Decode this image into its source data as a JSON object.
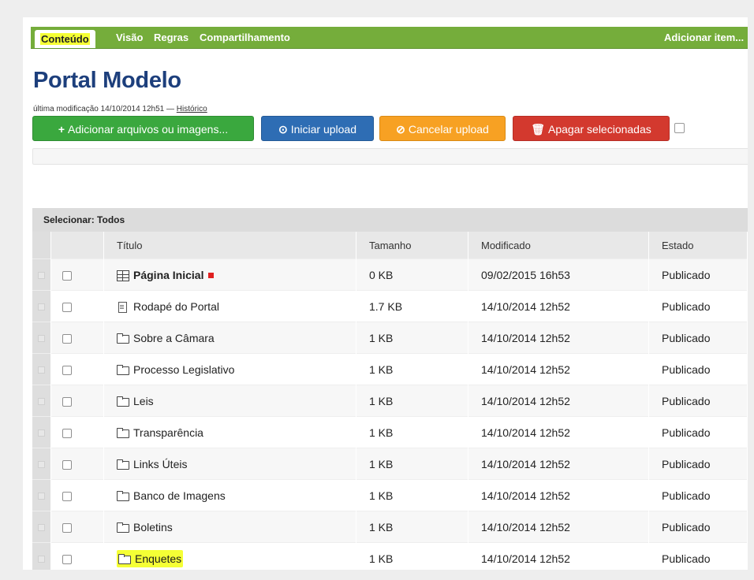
{
  "tabs": [
    {
      "label": "Conteúdo",
      "active": true
    },
    {
      "label": "Visão"
    },
    {
      "label": "Regras"
    },
    {
      "label": "Compartilhamento"
    }
  ],
  "toolbar_right": "Adicionar item...",
  "page_title": "Portal Modelo",
  "byline": {
    "text": "última modificação 14/10/2014 12h51 —",
    "link": "Histórico"
  },
  "buttons": {
    "add": {
      "icon": "+",
      "label": "Adicionar arquivos ou imagens..."
    },
    "start": {
      "icon": "⊙",
      "label": "Iniciar upload"
    },
    "cancel": {
      "icon": "⊘",
      "label": "Cancelar upload"
    },
    "delete": {
      "icon": "🗑",
      "label": "Apagar selecionadas"
    }
  },
  "select_bar": {
    "label": "Selecionar:",
    "value": "Todos"
  },
  "columns": [
    "Título",
    "Tamanho",
    "Modificado",
    "Estado"
  ],
  "rows": [
    {
      "icon": "grid-icon",
      "title": "Página Inicial",
      "size": "0 KB",
      "modified": "09/02/2015 16h53",
      "state": "Publicado"
    },
    {
      "icon": "page-icon",
      "title": "Rodapé do Portal",
      "size": "1.7 KB",
      "modified": "14/10/2014 12h52",
      "state": "Publicado"
    },
    {
      "icon": "folder-icon",
      "title": "Sobre a Câmara",
      "size": "1 KB",
      "modified": "14/10/2014 12h52",
      "state": "Publicado"
    },
    {
      "icon": "folder-icon",
      "title": "Processo Legislativo",
      "size": "1 KB",
      "modified": "14/10/2014 12h52",
      "state": "Publicado"
    },
    {
      "icon": "folder-icon",
      "title": "Leis",
      "size": "1 KB",
      "modified": "14/10/2014 12h52",
      "state": "Publicado"
    },
    {
      "icon": "folder-icon",
      "title": "Transparência",
      "size": "1 KB",
      "modified": "14/10/2014 12h52",
      "state": "Publicado"
    },
    {
      "icon": "folder-icon",
      "title": "Links Úteis",
      "size": "1 KB",
      "modified": "14/10/2014 12h52",
      "state": "Publicado"
    },
    {
      "icon": "folder-icon",
      "title": "Banco de Imagens",
      "size": "1 KB",
      "modified": "14/10/2014 12h52",
      "state": "Publicado"
    },
    {
      "icon": "folder-icon",
      "title": "Boletins",
      "size": "1 KB",
      "modified": "14/10/2014 12h52",
      "state": "Publicado"
    },
    {
      "icon": "folder-icon",
      "title": "Enquetes",
      "size": "1 KB",
      "modified": "14/10/2014 12h52",
      "state": "Publicado"
    }
  ],
  "colors": {
    "toolbar": "#75ad3b",
    "title": "#1d3f7c",
    "highlight": "#f5ff35"
  }
}
